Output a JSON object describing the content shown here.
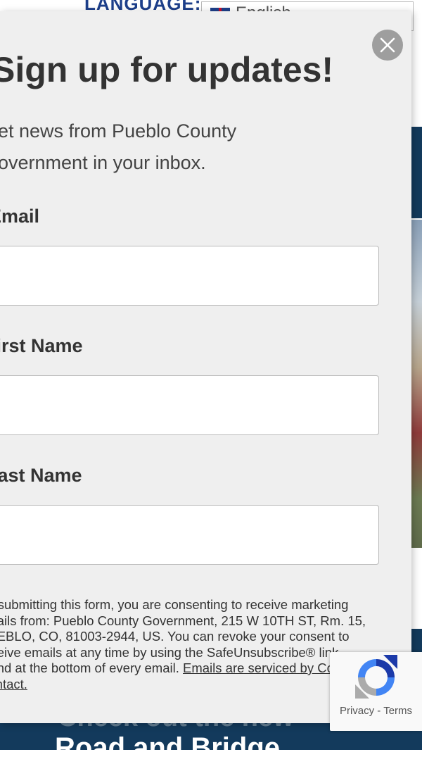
{
  "background": {
    "language_label": "LANGUAGE:",
    "language_value": "English",
    "promo_line_faded": "Check out the new",
    "promo_line": "Road and Bridge"
  },
  "modal": {
    "title": "Sign up for updates!",
    "description": "Get news from Pueblo County Government in your inbox.",
    "fields": [
      {
        "label": "Email",
        "value": ""
      },
      {
        "label": "First Name",
        "value": ""
      },
      {
        "label": "Last Name",
        "value": ""
      }
    ],
    "legal_text": "By submitting this form, you are consenting to receive marketing emails from: Pueblo County Government, 215 W 10TH ST, Rm. 15, PUEBLO, CO, 81003-2944, US. You can revoke your consent to receive emails at any time by using the SafeUnsubscribe® link, found at the bottom of every email.",
    "legal_link": "Emails are serviced by Constant Contact."
  },
  "recaptcha": {
    "privacy": "Privacy",
    "separator": " - ",
    "terms": "Terms"
  },
  "colors": {
    "navy": "#133a5c",
    "modal_bg": "#efefef",
    "close_bg": "#9e9e9e"
  }
}
